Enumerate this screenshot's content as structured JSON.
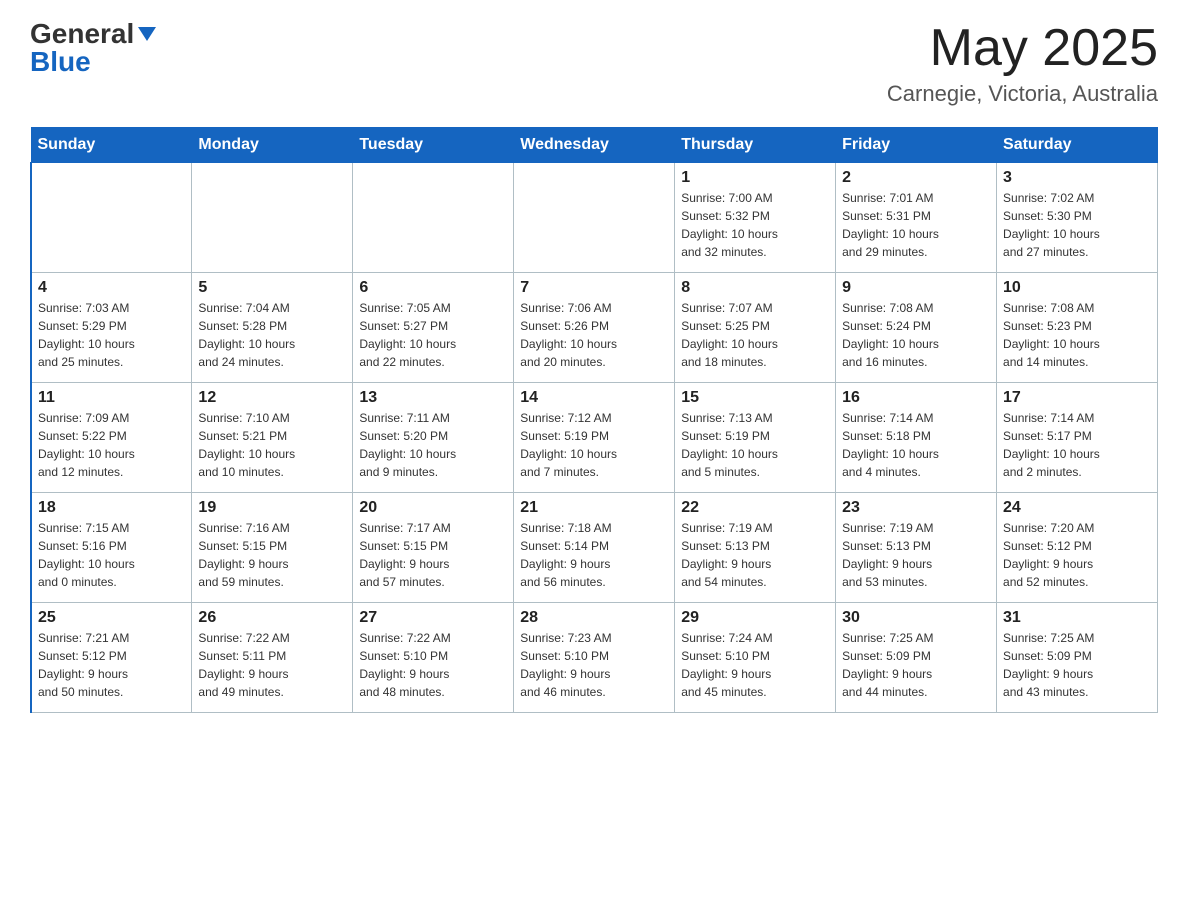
{
  "header": {
    "logo_line1": "General",
    "logo_line2": "Blue",
    "month": "May 2025",
    "location": "Carnegie, Victoria, Australia"
  },
  "days_of_week": [
    "Sunday",
    "Monday",
    "Tuesday",
    "Wednesday",
    "Thursday",
    "Friday",
    "Saturday"
  ],
  "weeks": [
    [
      {
        "day": "",
        "info": ""
      },
      {
        "day": "",
        "info": ""
      },
      {
        "day": "",
        "info": ""
      },
      {
        "day": "",
        "info": ""
      },
      {
        "day": "1",
        "info": "Sunrise: 7:00 AM\nSunset: 5:32 PM\nDaylight: 10 hours\nand 32 minutes."
      },
      {
        "day": "2",
        "info": "Sunrise: 7:01 AM\nSunset: 5:31 PM\nDaylight: 10 hours\nand 29 minutes."
      },
      {
        "day": "3",
        "info": "Sunrise: 7:02 AM\nSunset: 5:30 PM\nDaylight: 10 hours\nand 27 minutes."
      }
    ],
    [
      {
        "day": "4",
        "info": "Sunrise: 7:03 AM\nSunset: 5:29 PM\nDaylight: 10 hours\nand 25 minutes."
      },
      {
        "day": "5",
        "info": "Sunrise: 7:04 AM\nSunset: 5:28 PM\nDaylight: 10 hours\nand 24 minutes."
      },
      {
        "day": "6",
        "info": "Sunrise: 7:05 AM\nSunset: 5:27 PM\nDaylight: 10 hours\nand 22 minutes."
      },
      {
        "day": "7",
        "info": "Sunrise: 7:06 AM\nSunset: 5:26 PM\nDaylight: 10 hours\nand 20 minutes."
      },
      {
        "day": "8",
        "info": "Sunrise: 7:07 AM\nSunset: 5:25 PM\nDaylight: 10 hours\nand 18 minutes."
      },
      {
        "day": "9",
        "info": "Sunrise: 7:08 AM\nSunset: 5:24 PM\nDaylight: 10 hours\nand 16 minutes."
      },
      {
        "day": "10",
        "info": "Sunrise: 7:08 AM\nSunset: 5:23 PM\nDaylight: 10 hours\nand 14 minutes."
      }
    ],
    [
      {
        "day": "11",
        "info": "Sunrise: 7:09 AM\nSunset: 5:22 PM\nDaylight: 10 hours\nand 12 minutes."
      },
      {
        "day": "12",
        "info": "Sunrise: 7:10 AM\nSunset: 5:21 PM\nDaylight: 10 hours\nand 10 minutes."
      },
      {
        "day": "13",
        "info": "Sunrise: 7:11 AM\nSunset: 5:20 PM\nDaylight: 10 hours\nand 9 minutes."
      },
      {
        "day": "14",
        "info": "Sunrise: 7:12 AM\nSunset: 5:19 PM\nDaylight: 10 hours\nand 7 minutes."
      },
      {
        "day": "15",
        "info": "Sunrise: 7:13 AM\nSunset: 5:19 PM\nDaylight: 10 hours\nand 5 minutes."
      },
      {
        "day": "16",
        "info": "Sunrise: 7:14 AM\nSunset: 5:18 PM\nDaylight: 10 hours\nand 4 minutes."
      },
      {
        "day": "17",
        "info": "Sunrise: 7:14 AM\nSunset: 5:17 PM\nDaylight: 10 hours\nand 2 minutes."
      }
    ],
    [
      {
        "day": "18",
        "info": "Sunrise: 7:15 AM\nSunset: 5:16 PM\nDaylight: 10 hours\nand 0 minutes."
      },
      {
        "day": "19",
        "info": "Sunrise: 7:16 AM\nSunset: 5:15 PM\nDaylight: 9 hours\nand 59 minutes."
      },
      {
        "day": "20",
        "info": "Sunrise: 7:17 AM\nSunset: 5:15 PM\nDaylight: 9 hours\nand 57 minutes."
      },
      {
        "day": "21",
        "info": "Sunrise: 7:18 AM\nSunset: 5:14 PM\nDaylight: 9 hours\nand 56 minutes."
      },
      {
        "day": "22",
        "info": "Sunrise: 7:19 AM\nSunset: 5:13 PM\nDaylight: 9 hours\nand 54 minutes."
      },
      {
        "day": "23",
        "info": "Sunrise: 7:19 AM\nSunset: 5:13 PM\nDaylight: 9 hours\nand 53 minutes."
      },
      {
        "day": "24",
        "info": "Sunrise: 7:20 AM\nSunset: 5:12 PM\nDaylight: 9 hours\nand 52 minutes."
      }
    ],
    [
      {
        "day": "25",
        "info": "Sunrise: 7:21 AM\nSunset: 5:12 PM\nDaylight: 9 hours\nand 50 minutes."
      },
      {
        "day": "26",
        "info": "Sunrise: 7:22 AM\nSunset: 5:11 PM\nDaylight: 9 hours\nand 49 minutes."
      },
      {
        "day": "27",
        "info": "Sunrise: 7:22 AM\nSunset: 5:10 PM\nDaylight: 9 hours\nand 48 minutes."
      },
      {
        "day": "28",
        "info": "Sunrise: 7:23 AM\nSunset: 5:10 PM\nDaylight: 9 hours\nand 46 minutes."
      },
      {
        "day": "29",
        "info": "Sunrise: 7:24 AM\nSunset: 5:10 PM\nDaylight: 9 hours\nand 45 minutes."
      },
      {
        "day": "30",
        "info": "Sunrise: 7:25 AM\nSunset: 5:09 PM\nDaylight: 9 hours\nand 44 minutes."
      },
      {
        "day": "31",
        "info": "Sunrise: 7:25 AM\nSunset: 5:09 PM\nDaylight: 9 hours\nand 43 minutes."
      }
    ]
  ]
}
